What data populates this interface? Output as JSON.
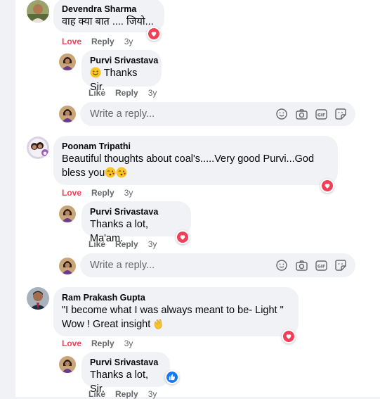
{
  "comments": [
    {
      "author": "Devendra Sharma",
      "text": "वाह क्या बात .... जियो...",
      "reaction_label": "Love",
      "reply_label": "Reply",
      "time": "3y",
      "replies": [
        {
          "author": "Purvi Srivastava",
          "text": "Thanks Sir.",
          "like_label": "Like",
          "reply_label": "Reply",
          "time": "3y"
        }
      ],
      "write_reply_placeholder": "Write a reply..."
    },
    {
      "author": "Poonam Tripathi",
      "text_line1": "Beautiful thoughts about coal's.....Very good Purvi...God",
      "text_line2": "bless you",
      "reaction_label": "Love",
      "reply_label": "Reply",
      "time": "3y",
      "replies": [
        {
          "author": "Purvi Srivastava",
          "text": "Thanks a lot, Ma'am.",
          "like_label": "Like",
          "reply_label": "Reply",
          "time": "3y"
        }
      ],
      "write_reply_placeholder": "Write a reply..."
    },
    {
      "author": "Ram Prakash Gupta",
      "text_line1": "\"I become what I was always meant to be- Light \"",
      "text_line2": "Wow ! Great insight",
      "reaction_label": "Love",
      "reply_label": "Reply",
      "time": "3y",
      "replies": [
        {
          "author": "Purvi Srivastava",
          "text": "Thanks a lot, Sir.",
          "like_label": "Like",
          "reply_label": "Reply",
          "time": "3y"
        }
      ]
    }
  ],
  "colors": {
    "love": "#f33e58",
    "muted": "#65676b",
    "bubble": "#f0f2f5",
    "like_blue": "#1877f2"
  },
  "icons": [
    "smiley-icon",
    "camera-icon",
    "gif-icon",
    "sticker-icon",
    "heart-icon",
    "thumbs-up-icon",
    "clapping-hands-emoji",
    "kissing-face-emoji",
    "smiling-face-emoji"
  ]
}
